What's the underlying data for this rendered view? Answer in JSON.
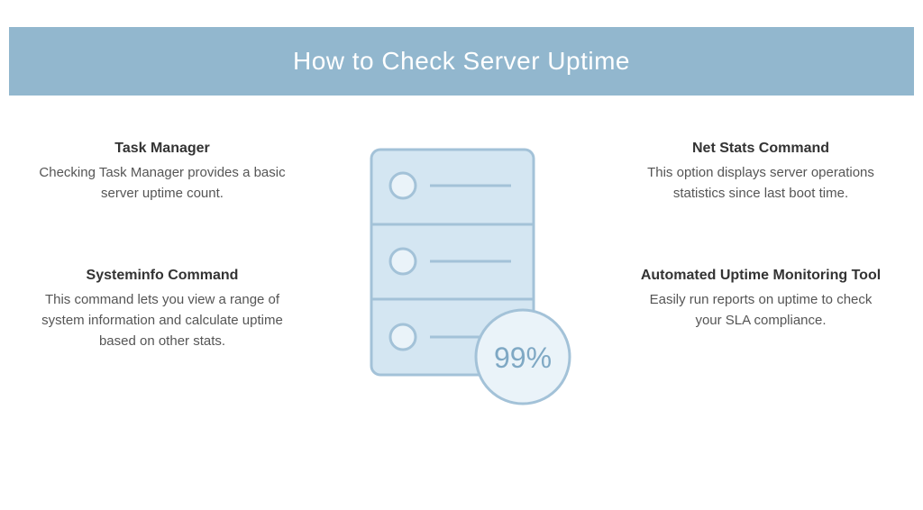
{
  "banner": {
    "title": "How to Check Server Uptime"
  },
  "left": {
    "item1": {
      "title": "Task Manager",
      "desc": "Checking Task Manager provides a basic server uptime count."
    },
    "item2": {
      "title": "Systeminfo Command",
      "desc": "This command lets you view a range of system information and calculate uptime based on other stats."
    }
  },
  "right": {
    "item1": {
      "title": "Net Stats Command",
      "desc": "This option displays server operations statistics since last boot time."
    },
    "item2": {
      "title": "Automated Uptime Monitoring Tool",
      "desc": "Easily run reports on uptime to check your SLA compliance."
    }
  },
  "illustration": {
    "badge_text": "99%"
  }
}
